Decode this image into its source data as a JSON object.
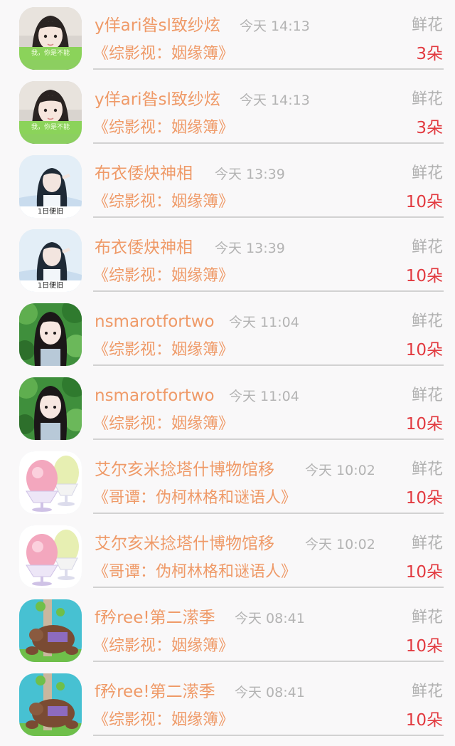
{
  "rows": [
    {
      "name": "y佯ari昝sl致纱炫",
      "time": "今天 14:13",
      "gift": "鲜花",
      "book": "《综影视：姻缘簿》",
      "count": "3朵",
      "avatar": "girl-green-banner",
      "avatar_text": "我，你是不能"
    },
    {
      "name": "y佯ari昝sl致纱炫",
      "time": "今天 14:13",
      "gift": "鲜花",
      "book": "《综影视：姻缘簿》",
      "count": "3朵",
      "avatar": "girl-green-banner",
      "avatar_text": "我，你是不能"
    },
    {
      "name": "布衣倭炔神相",
      "time": "今天 13:39",
      "gift": "鲜花",
      "book": "《综影视：姻缘簿》",
      "count": "10朵",
      "avatar": "girl-light-caption",
      "avatar_text": "1日便旧"
    },
    {
      "name": "布衣倭炔神相",
      "time": "今天 13:39",
      "gift": "鲜花",
      "book": "《综影视：姻缘簿》",
      "count": "10朵",
      "avatar": "girl-light-caption",
      "avatar_text": "1日便旧"
    },
    {
      "name": "nsmarotfortwo",
      "time": "今天 11:04",
      "gift": "鲜花",
      "book": "《综影视：姻缘簿》",
      "count": "10朵",
      "avatar": "girl-forest",
      "avatar_text": ""
    },
    {
      "name": "nsmarotfortwo",
      "time": "今天 11:04",
      "gift": "鲜花",
      "book": "《综影视：姻缘簿》",
      "count": "10朵",
      "avatar": "girl-forest",
      "avatar_text": ""
    },
    {
      "name": "艾尔亥米捻塔什博物馆移",
      "time": "今天 10:02",
      "gift": "鲜花",
      "book": "《哥谭：伪柯林格和谜语人》",
      "count": "10朵",
      "avatar": "shaved-ice",
      "avatar_text": ""
    },
    {
      "name": "艾尔亥米捻塔什博物馆移",
      "time": "今天 10:02",
      "gift": "鲜花",
      "book": "《哥谭：伪柯林格和谜语人》",
      "count": "10朵",
      "avatar": "shaved-ice",
      "avatar_text": ""
    },
    {
      "name": "f矜ree!第二潆季",
      "time": "今天 08:41",
      "gift": "鲜花",
      "book": "《综影视：姻缘簿》",
      "count": "10朵",
      "avatar": "cartoon-bear",
      "avatar_text": ""
    },
    {
      "name": "f矜ree!第二潆季",
      "time": "今天 08:41",
      "gift": "鲜花",
      "book": "《综影视：姻缘簿》",
      "count": "10朵",
      "avatar": "cartoon-bear",
      "avatar_text": ""
    }
  ]
}
